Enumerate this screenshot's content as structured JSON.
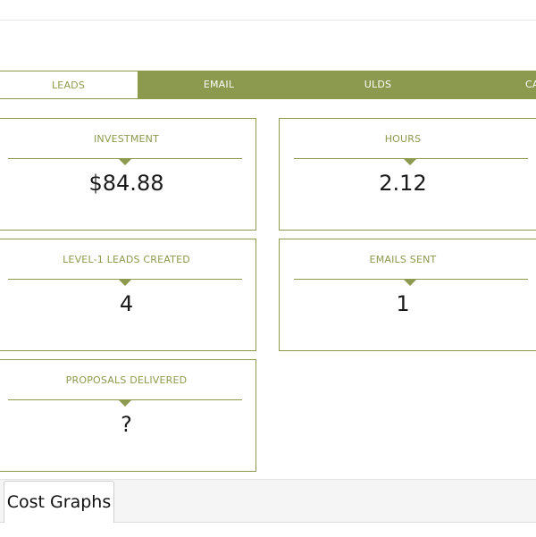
{
  "tabs": [
    {
      "label": "LEADS"
    },
    {
      "label": "EMAIL"
    },
    {
      "label": "ULDS"
    },
    {
      "label": "CA"
    }
  ],
  "active_tab": "LEADS",
  "colors": {
    "accent": "#8c9a4f",
    "text": "#1a1a1a",
    "background": "#ffffff"
  },
  "metrics": {
    "investment": {
      "title": "INVESTMENT",
      "value": "$84.88"
    },
    "hours": {
      "title": "HOURS",
      "value": "2.12"
    },
    "leads_created": {
      "title": "LEVEL-1 LEADS CREATED",
      "value": "4"
    },
    "emails_sent": {
      "title": "EMAILS SENT",
      "value": "1"
    },
    "proposals_delivered": {
      "title": "PROPOSALS DELIVERED",
      "value": "?"
    }
  },
  "section": {
    "tab_label": "Cost Graphs"
  }
}
